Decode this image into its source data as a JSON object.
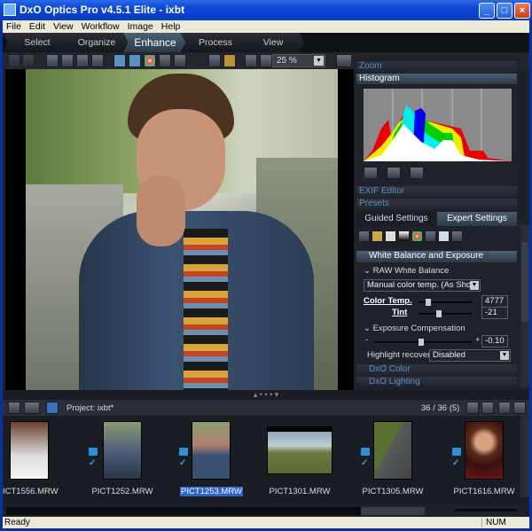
{
  "window": {
    "title": "DxO Optics Pro v4.5.1 Elite - ixbt"
  },
  "menu": [
    "File",
    "Edit",
    "View",
    "Workflow",
    "Image",
    "Help"
  ],
  "workflow_tabs": [
    "Select",
    "Organize",
    "Enhance",
    "Process",
    "View"
  ],
  "toolbar": {
    "zoom_value": "25 %"
  },
  "panel": {
    "zoom": "Zoom",
    "histogram": "Histogram",
    "exif": "EXIF Editor",
    "presets": "Presets",
    "guided": "Guided Settings",
    "expert": "Expert Settings",
    "wb_section": "White Balance and Exposure",
    "raw_wb": "RAW White Balance",
    "wb_mode": "Manual color temp. (As Shot)",
    "color_temp_label": "Color Temp.",
    "color_temp": "4777",
    "tint_label": "Tint",
    "tint": "-21",
    "exposure_label": "Exposure Compensation",
    "exposure": "-0.10",
    "highlight_label": "Highlight recovery",
    "highlight": "Disabled",
    "dxo_color": "DxO Color",
    "dxo_lighting": "DxO Lighting",
    "minus": "-",
    "plus": "+"
  },
  "filmstrip": {
    "project": "Project:  ixbt*",
    "count": "36 / 36 (5)",
    "items": [
      {
        "name": "ICT1556.MRW",
        "selected": false
      },
      {
        "name": "PICT1252.MRW",
        "selected": false
      },
      {
        "name": "PICT1253.MRW",
        "selected": true
      },
      {
        "name": "PICT1301.MRW",
        "selected": false
      },
      {
        "name": "PICT1305.MRW",
        "selected": false
      },
      {
        "name": "PICT1616.MRW",
        "selected": false
      }
    ]
  },
  "status": {
    "text": "Ready",
    "num": "NUM"
  }
}
